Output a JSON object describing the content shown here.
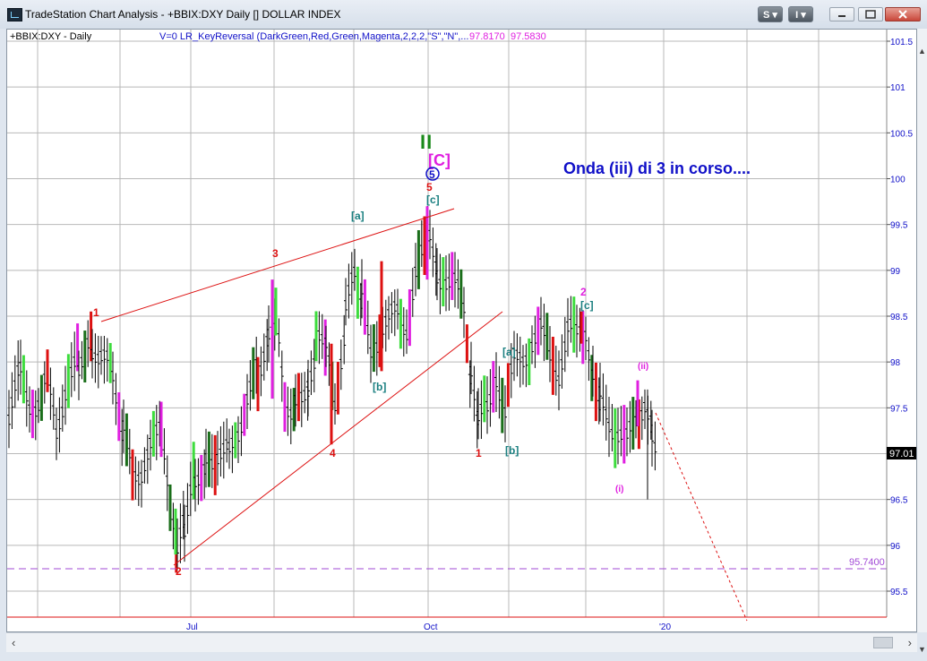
{
  "window": {
    "title": "TradeStation Chart Analysis - +BBIX:DXY Daily [] DOLLAR INDEX",
    "btn_s": "S",
    "btn_i": "I"
  },
  "chart": {
    "symbol_label": "+BBIX:DXY - Daily",
    "indicator_text": "V=0  LR_KeyReversal (DarkGreen,Red,Green,Magenta,2,2,2,\"S\",\"N\",...",
    "indicator_val1": "97.8170",
    "indicator_val2": "97.5830",
    "last_price": "97.01",
    "hline_value": "95.7400",
    "annotation": "Onda (iii) di 3 in corso....",
    "colors": {
      "up": "#000000",
      "red": "#dd1111",
      "magenta": "#e020e0",
      "teal": "#1a7f80",
      "blue": "#1010c8",
      "violet": "#a24ad6"
    },
    "y_ticks": [
      "101.5",
      "101",
      "100.5",
      "100",
      "99.5",
      "99",
      "98.5",
      "98",
      "97.5",
      "97",
      "96.5",
      "96",
      "95.5"
    ],
    "x_ticks": [
      "Jul",
      "Oct",
      "'20"
    ],
    "wave_labels": [
      {
        "t": "1",
        "c": "red"
      },
      {
        "t": "2",
        "c": "red"
      },
      {
        "t": "3",
        "c": "red"
      },
      {
        "t": "4",
        "c": "red"
      },
      {
        "t": "5",
        "c": "red"
      },
      {
        "t": "5",
        "c": "blue"
      },
      {
        "t": "[C]",
        "c": "magenta"
      },
      {
        "t": "[a]",
        "c": "teal"
      },
      {
        "t": "[b]",
        "c": "teal"
      },
      {
        "t": "[c]",
        "c": "teal"
      },
      {
        "t": "1",
        "c": "red"
      },
      {
        "t": "[a]",
        "c": "teal"
      },
      {
        "t": "[b]",
        "c": "teal"
      },
      {
        "t": "[c]",
        "c": "teal"
      },
      {
        "t": "2",
        "c": "magenta"
      },
      {
        "t": "(i)",
        "c": "magenta"
      },
      {
        "t": "(ii)",
        "c": "magenta"
      }
    ],
    "key_bar": "II"
  }
}
